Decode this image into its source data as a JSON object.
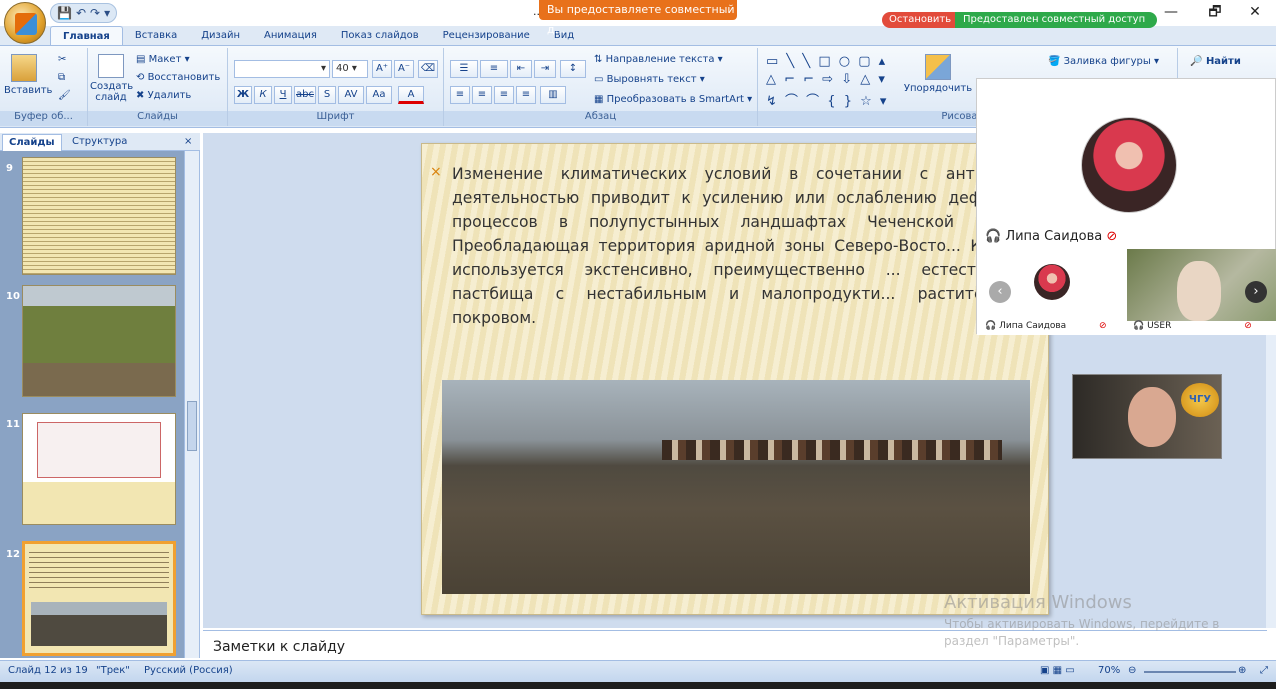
{
  "window": {
    "title": "...nt",
    "share_banner": "Вы предоставляете совместный д...",
    "stop_label": "Остановить",
    "shared_label": "Предоставлен совместный доступ",
    "minimize": "—",
    "maximize": "🗗",
    "close": "✕"
  },
  "tabs": [
    "Главная",
    "Вставка",
    "Дизайн",
    "Анимация",
    "Показ слайдов",
    "Рецензирование",
    "Вид"
  ],
  "ribbon": {
    "paste": "Вставить",
    "clipboard_group": "Буфер об...",
    "new_slide": "Создать слайд",
    "layout": "Макет",
    "reset": "Восстановить",
    "delete": "Удалить",
    "slides_group": "Слайды",
    "font_size": "40",
    "font_group": "Шрифт",
    "font_bold": "Ж",
    "font_italic": "К",
    "font_underline": "Ч",
    "font_strike": "abc",
    "font_shadow": "S",
    "font_spacing": "AV",
    "font_case": "Aa",
    "font_color": "A",
    "grow_font": "A⁺",
    "shrink_font": "A⁻",
    "text_direction": "Направление текста",
    "align_text": "Выровнять текст",
    "convert_smartart": "Преобразовать в SmartArt",
    "paragraph_group": "Абзац",
    "arrange": "Упорядочить",
    "drawing_group": "Рисован...",
    "shape_fill": "Заливка фигуры",
    "find": "Найти"
  },
  "left_pane": {
    "tab_slides": "Слайды",
    "tab_outline": "Структура",
    "close": "×",
    "thumbs": [
      {
        "num": "9"
      },
      {
        "num": "10"
      },
      {
        "num": "11"
      },
      {
        "num": "12"
      }
    ]
  },
  "slide": {
    "bullet": "×",
    "text": "Изменение климатических условий в сочетании с антропог... деятельностью приводит к усилению или ослаблению дефляци... процессов в полупустынных ландшафтах Чеченской Респу... Преобладающая территория аридной зоны Северо-Восто... Кавказа используется экстенсивно, преимущественно ... естественные пастбища с нестабильным и малопродукти... растительным покровом."
  },
  "notes_placeholder": "Заметки к слайду",
  "call": {
    "main_participant": "Липа Саидова",
    "tile_left_name": "Липа Саидова",
    "tile_right_name": "USER",
    "presenter_badge": "ЧГУ"
  },
  "activation": {
    "title": "Активация Windows",
    "line1": "Чтобы активировать Windows, перейдите в",
    "line2": "раздел \"Параметры\"."
  },
  "status": {
    "slide_info": "Слайд 12 из 19",
    "theme": "\"Трек\"",
    "language": "Русский (Россия)",
    "zoom": "70%"
  },
  "colors": {
    "accent_orange": "#e8711b",
    "stop_red": "#e24b3b",
    "shared_green": "#2ea94a",
    "ribbon_blue": "#15428b"
  }
}
